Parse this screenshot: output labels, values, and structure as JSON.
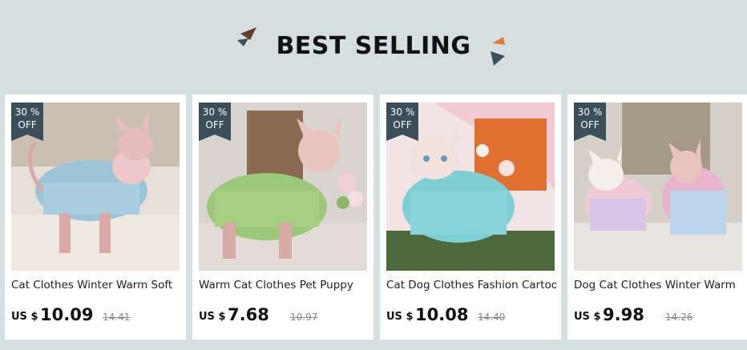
{
  "section": {
    "title": "BEST SELLING"
  },
  "products": [
    {
      "discount_value": "30 %",
      "discount_label": "OFF",
      "name": "Cat Clothes Winter Warm Soft",
      "currency": "US $",
      "price": "10.09",
      "original_price": "14.41",
      "image": "hairless-cat-in-blue-pink-striped-sweater"
    },
    {
      "discount_value": "30 %",
      "discount_label": "OFF",
      "name": "Warm Cat Clothes Pet Puppy",
      "currency": "US $",
      "price": "7.68",
      "original_price": "10.97",
      "image": "hairless-cat-in-green-shirt-with-flowers"
    },
    {
      "discount_value": "30 %",
      "discount_label": "OFF",
      "name": "Cat Dog Clothes Fashion Cartoon",
      "currency": "US $",
      "price": "10.08",
      "original_price": "14.40",
      "image": "hairless-cat-in-teal-hoodie"
    },
    {
      "discount_value": "30 %",
      "discount_label": "OFF",
      "name": "Dog Cat Clothes Winter Warm",
      "currency": "US $",
      "price": "9.98",
      "original_price": "14.26",
      "image": "two-cats-in-tie-dye-pajamas"
    }
  ],
  "colors": {
    "background": "#d6dfe0",
    "badge": "#3a4f5a",
    "card": "#ffffff"
  }
}
